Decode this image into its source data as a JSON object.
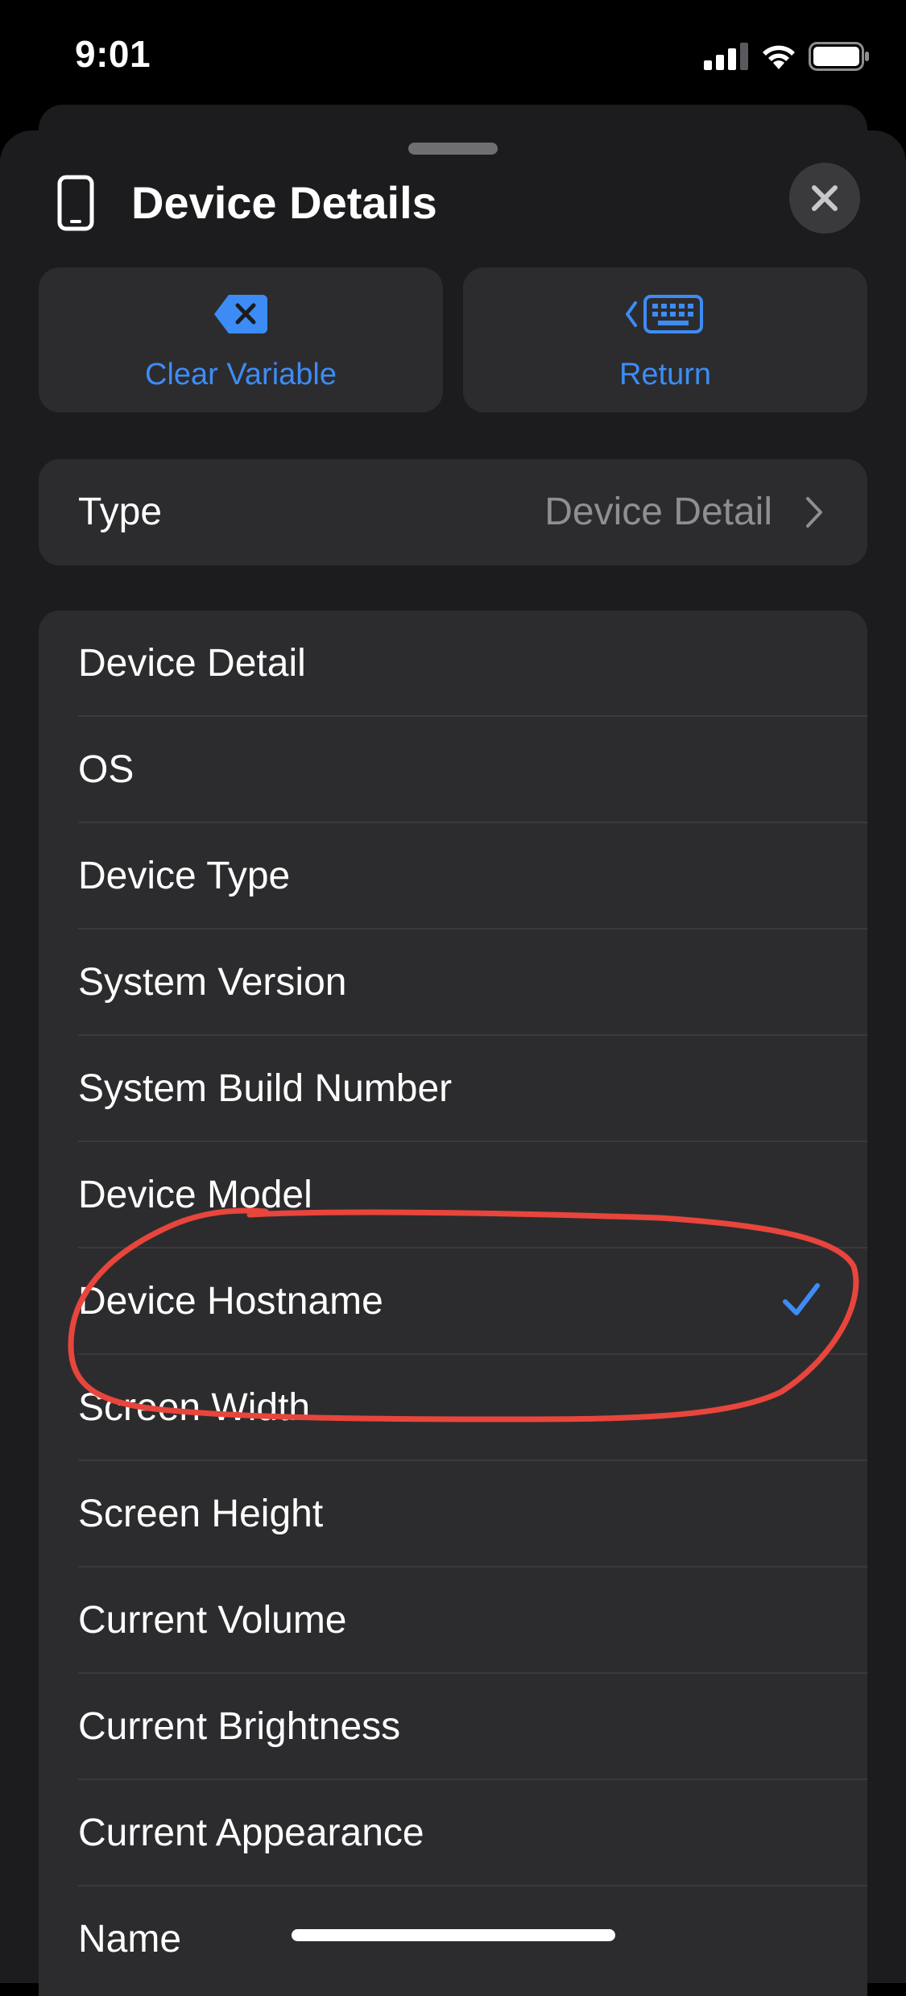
{
  "status_bar": {
    "time": "9:01"
  },
  "sheet": {
    "title": "Device Details",
    "header_icon": "iphone-icon",
    "close_icon": "close-icon"
  },
  "actions": {
    "clear_variable": {
      "label": "Clear Variable",
      "icon": "delete-left-icon"
    },
    "return": {
      "label": "Return",
      "icon": "keyboard-icon"
    }
  },
  "type_row": {
    "label": "Type",
    "value": "Device Detail"
  },
  "options": {
    "items": [
      {
        "label": "Device Detail",
        "selected": false
      },
      {
        "label": "OS",
        "selected": false
      },
      {
        "label": "Device Type",
        "selected": false
      },
      {
        "label": "System Version",
        "selected": false
      },
      {
        "label": "System Build Number",
        "selected": false
      },
      {
        "label": "Device Model",
        "selected": false
      },
      {
        "label": "Device Hostname",
        "selected": true
      },
      {
        "label": "Screen Width",
        "selected": false
      },
      {
        "label": "Screen Height",
        "selected": false
      },
      {
        "label": "Current Volume",
        "selected": false
      },
      {
        "label": "Current Brightness",
        "selected": false
      },
      {
        "label": "Current Appearance",
        "selected": false
      },
      {
        "label": "Name",
        "selected": false
      }
    ]
  },
  "colors": {
    "accent": "#3d8cf5",
    "annotation": "#e8453c",
    "background": "#000000",
    "sheet": "#1c1c1e",
    "cell": "#2c2c2e"
  }
}
